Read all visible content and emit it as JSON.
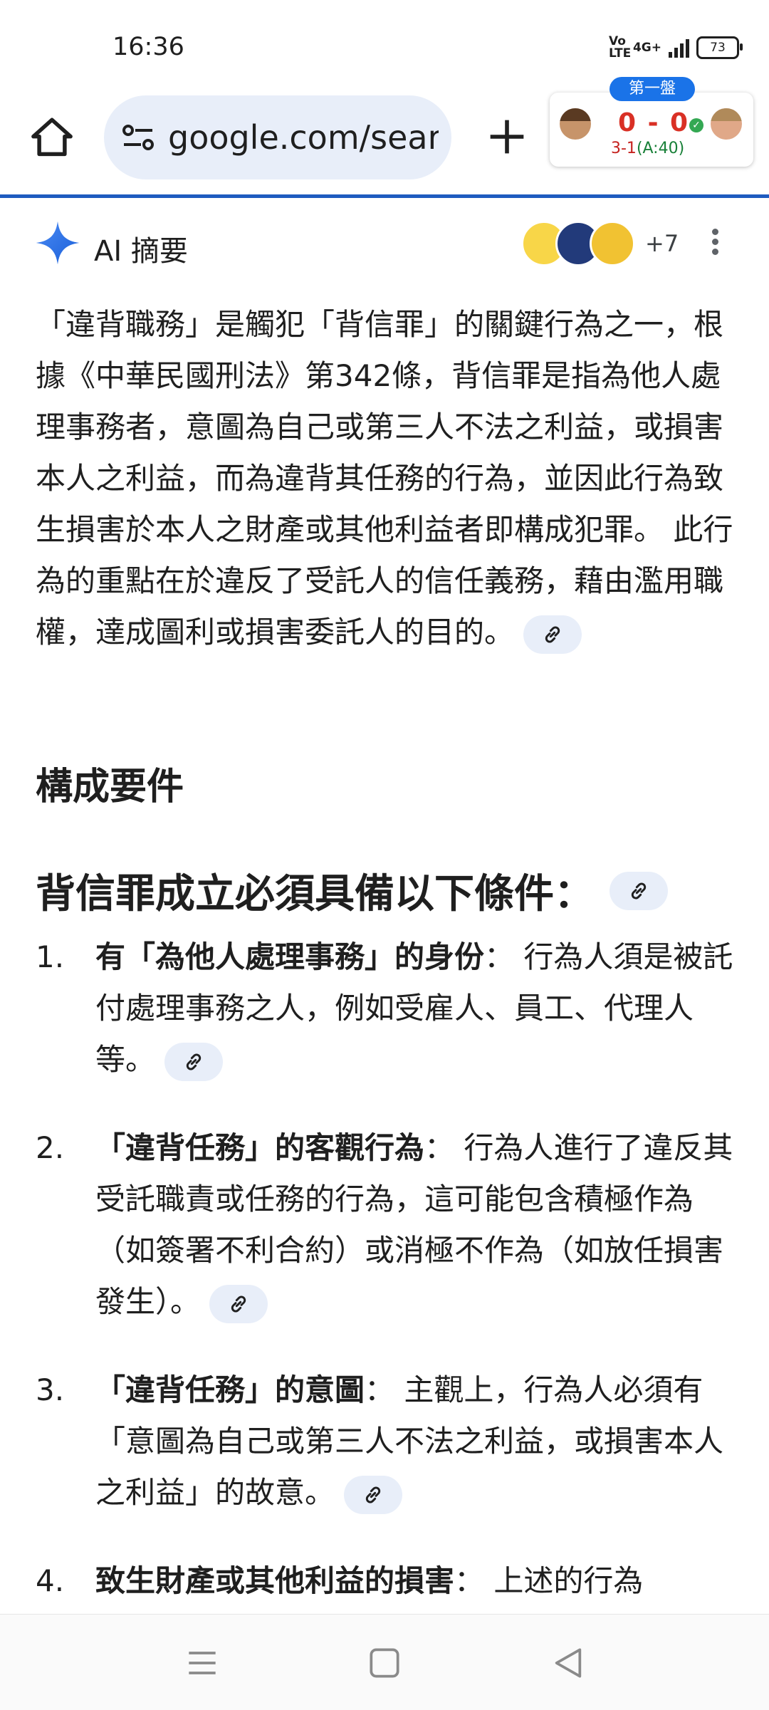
{
  "status_bar": {
    "time": "16:36",
    "volte": "Vo LTE",
    "network": "4G+",
    "battery": "73"
  },
  "browser": {
    "url": "google.com/search",
    "icons": [
      "home-icon",
      "site-settings-icon",
      "new-tab-icon"
    ]
  },
  "score_widget": {
    "badge": "第一盤",
    "score": "0 - 0",
    "set_label": "3-1",
    "set_detail": "(A:40)",
    "colors": {
      "score": "#d93025",
      "badge": "#1a73e8"
    }
  },
  "ai_overview": {
    "title": "AI 摘要",
    "source_count": "+7",
    "intro": "「違背職務」是觸犯「背信罪」的關鍵行為之一，根據《中華民國刑法》第342條，背信罪是指為他人處理事務者，意圖為自己或第三人不法之利益，或損害本人之利益，而為違背其任務的行為，並因此行為致生損害於本人之財產或其他利益者即構成犯罪。 此行為的重點在於違反了受託人的信任義務，藉由濫用職權，達成圖利或損害委託人的目的。",
    "heading1": "構成要件",
    "heading2": "背信罪成立必須具備以下條件：",
    "items": [
      {
        "num": "1.",
        "bold": "有「為他人處理事務」的身份",
        "text": "： 行為人須是被託付處理事務之人，例如受雇人、員工、代理人等。"
      },
      {
        "num": "2.",
        "bold": "「違背任務」的客觀行為",
        "text": "： 行為人進行了違反其受託職責或任務的行為，這可能包含積極作為（如簽署不利合約）或消極不作為（如放任損害發生）。"
      },
      {
        "num": "3.",
        "bold": "「違背任務」的意圖",
        "text": "： 主觀上，行為人必須有「意圖為自己或第三人不法之利益，或損害本人之利益」的故意。"
      },
      {
        "num": "4.",
        "bold": "致生財產或其他利益的損害",
        "text": "： 上述的行為"
      }
    ]
  },
  "nav": {
    "icons": [
      "menu-icon",
      "home-square-icon",
      "back-triangle-icon"
    ]
  }
}
